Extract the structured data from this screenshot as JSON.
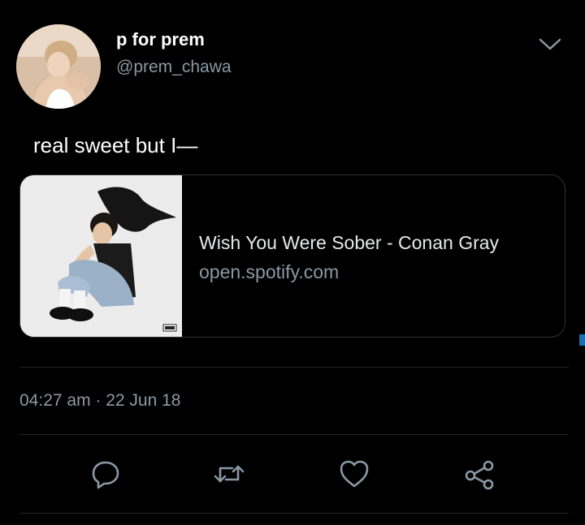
{
  "user": {
    "display_name": "p for prem",
    "handle": "@prem_chawa"
  },
  "tweet": {
    "text": "real sweet but I—",
    "timestamp": "04:27 am · 22 Jun 18"
  },
  "link_card": {
    "title": "Wish You Were Sober - Conan Gray",
    "domain": "open.spotify.com"
  },
  "actions": {
    "reply_icon": "reply-icon",
    "retweet_icon": "retweet-icon",
    "like_icon": "heart-icon",
    "share_icon": "share-icon"
  },
  "colors": {
    "background": "#000000",
    "text_primary": "#ffffff",
    "text_secondary": "#8b98a5",
    "border": "#2f3336"
  }
}
